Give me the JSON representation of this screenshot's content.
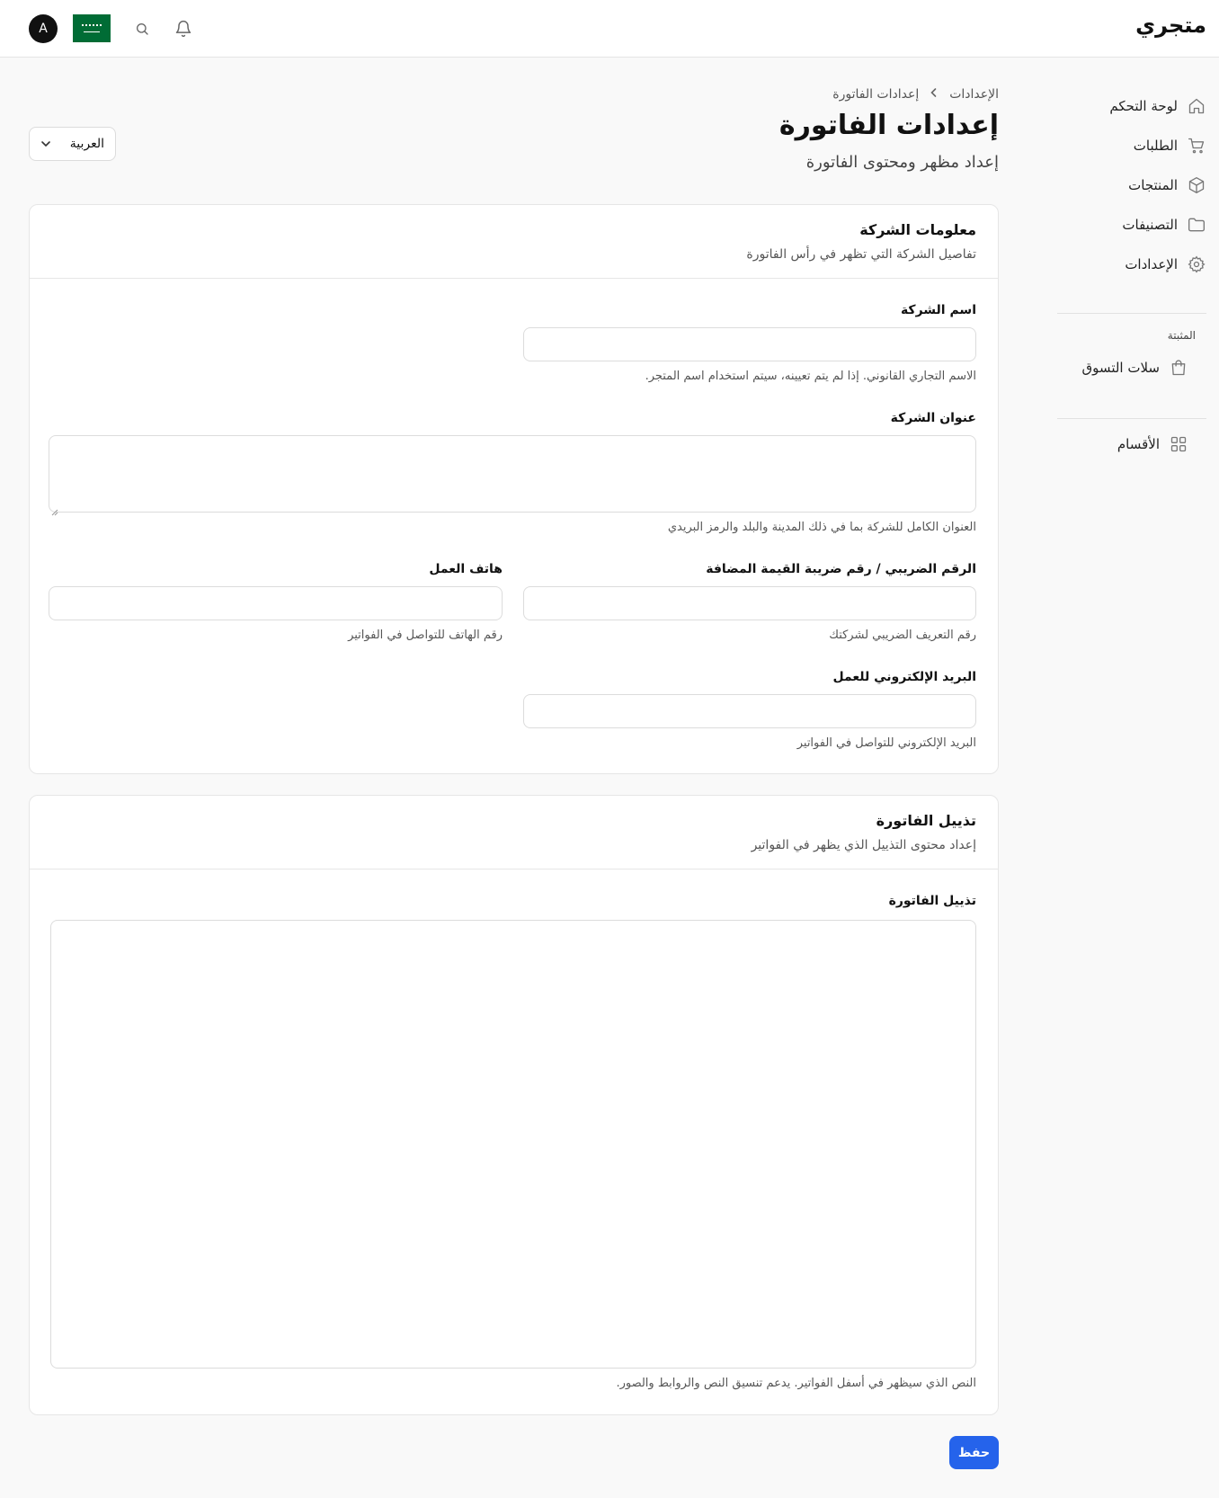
{
  "header": {
    "brand": "متجري",
    "avatar_initial": "A"
  },
  "sidebar": {
    "items": [
      {
        "label": "لوحة التحكم",
        "icon": "home-icon"
      },
      {
        "label": "الطلبات",
        "icon": "cart-icon"
      },
      {
        "label": "المنتجات",
        "icon": "box-icon"
      },
      {
        "label": "التصنيفات",
        "icon": "folder-icon"
      },
      {
        "label": "الإعدادات",
        "icon": "gear-icon"
      }
    ],
    "pinned_title": "المثبتة",
    "pinned_items": [
      {
        "label": "سلات التسوق",
        "icon": "shopping-bag-icon"
      }
    ],
    "extra_items": [
      {
        "label": "الأقسام",
        "icon": "grid-icon"
      }
    ]
  },
  "breadcrumb": {
    "parent": "الإعدادات",
    "separator": "›",
    "current": "إعدادات الفاتورة"
  },
  "page": {
    "title": "إعدادات الفاتورة",
    "subtitle": "إعداد مظهر ومحتوى الفاتورة"
  },
  "language_select": {
    "value": "العربية"
  },
  "company_card": {
    "title": "معلومات الشركة",
    "description": "تفاصيل الشركة التي تظهر في رأس الفاتورة",
    "company_name": {
      "label": "اسم الشركة",
      "value": "",
      "help": "الاسم التجاري القانوني. إذا لم يتم تعيينه، سيتم استخدام اسم المتجر."
    },
    "company_address": {
      "label": "عنوان الشركة",
      "value": "",
      "help": "العنوان الكامل للشركة بما في ذلك المدينة والبلد والرمز البريدي"
    },
    "tax_number": {
      "label": "الرقم الضريبي / رقم ضريبة القيمة المضافة",
      "value": "",
      "help": "رقم التعريف الضريبي لشركتك"
    },
    "work_phone": {
      "label": "هاتف العمل",
      "value": "",
      "help": "رقم الهاتف للتواصل في الفواتير"
    },
    "work_email": {
      "label": "البريد الإلكتروني للعمل",
      "value": "",
      "help": "البريد الإلكتروني للتواصل في الفواتير"
    }
  },
  "footer_card": {
    "title": "تذييل الفاتورة",
    "description": "إعداد محتوى التذييل الذي يظهر في الفواتير",
    "footer_field": {
      "label": "تذييل الفاتورة",
      "value": "",
      "help": "النص الذي سيظهر في أسفل الفواتير. يدعم تنسيق النص والروابط والصور."
    }
  },
  "actions": {
    "save_label": "حفظ"
  },
  "colors": {
    "primary": "#2563eb",
    "flag_green": "#006c35"
  }
}
